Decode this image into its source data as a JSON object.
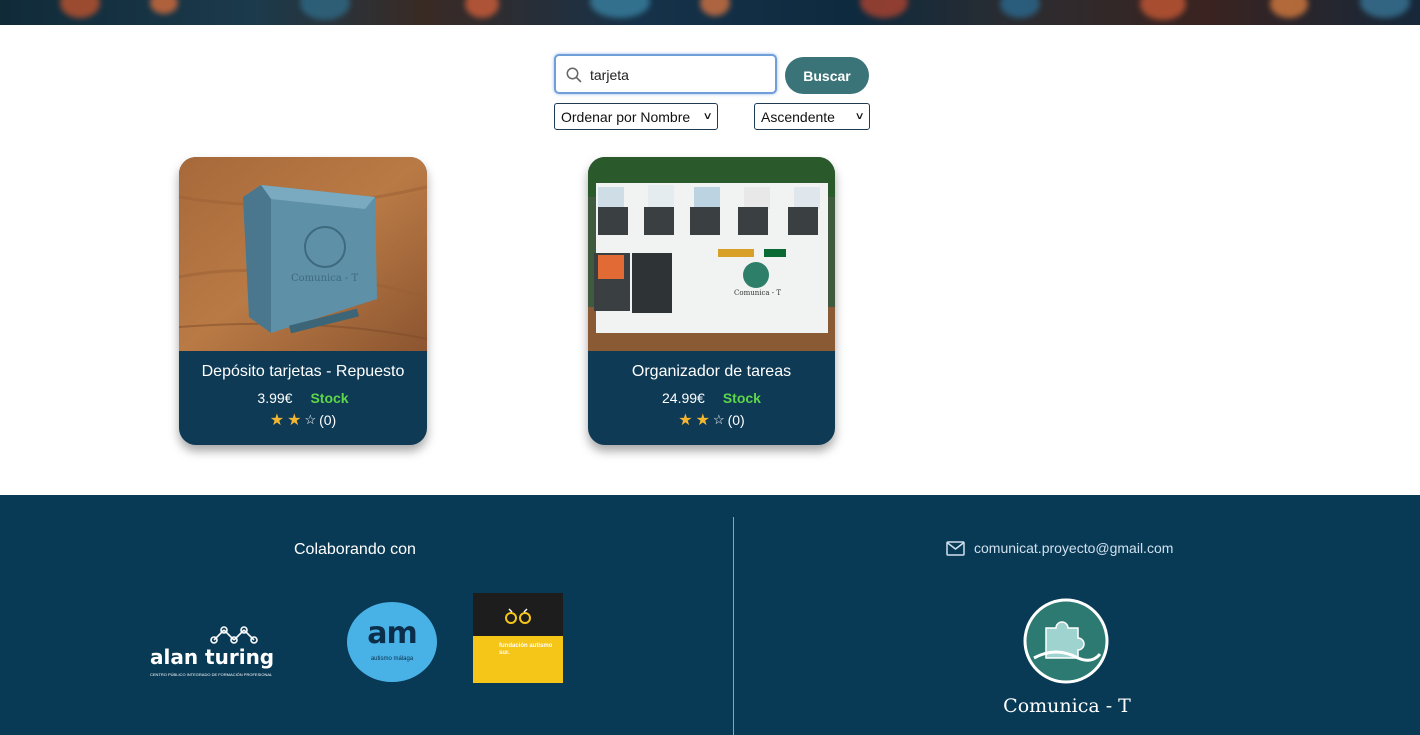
{
  "search": {
    "value": "tarjeta",
    "button_label": "Buscar"
  },
  "sort": {
    "order_selected": "Ordenar por Nombre",
    "direction_selected": "Ascendente"
  },
  "products": [
    {
      "title": "Depósito tarjetas - Repuesto",
      "price": "3.99€",
      "stock": "Stock",
      "rating_stars": 2,
      "rating_max": 3,
      "rating_count": "(0)"
    },
    {
      "title": "Organizador de tareas",
      "price": "24.99€",
      "stock": "Stock",
      "rating_stars": 2,
      "rating_max": 3,
      "rating_count": "(0)"
    }
  ],
  "footer": {
    "collab_title": "Colaborando con",
    "partners": [
      {
        "name": "alan turing",
        "subtitle": "CENTRO PÚBLICO INTEGRADO DE FORMACIÓN PROFESIONAL"
      },
      {
        "name": "am",
        "subtitle": "autismo málaga"
      },
      {
        "name": "fundación autismo sur."
      }
    ],
    "email": "comunicat.proyecto@gmail.com",
    "brand_name": "Comunica - T"
  },
  "colors": {
    "primary_button": "#3a7478",
    "card_bg": "#0e3a55",
    "footer_bg": "#093a55",
    "stock_green": "#5dd64a",
    "star_gold": "#f3b631"
  },
  "icons": [
    "search-icon",
    "chevron-down-icon",
    "star-icon",
    "mail-icon"
  ]
}
